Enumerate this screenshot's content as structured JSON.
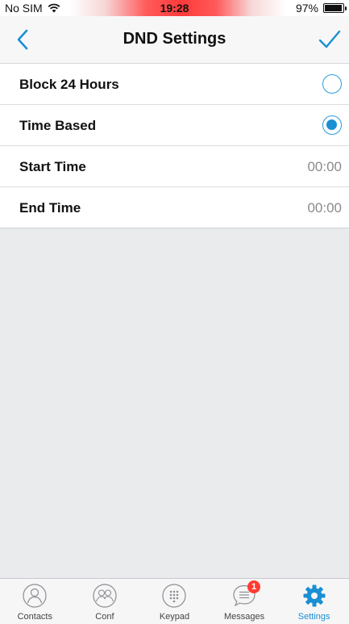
{
  "status_bar": {
    "carrier": "No SIM",
    "time": "19:28",
    "battery_text": "97%",
    "battery_level": 0.97
  },
  "nav": {
    "back_icon": "chevron-left-icon",
    "title": "DND Settings",
    "done_icon": "checkmark-icon"
  },
  "settings": {
    "rows": [
      {
        "label": "Block 24 Hours",
        "type": "radio",
        "selected": false
      },
      {
        "label": "Time Based",
        "type": "radio",
        "selected": true
      },
      {
        "label": "Start Time",
        "type": "value",
        "value": "00:00"
      },
      {
        "label": "End Time",
        "type": "value",
        "value": "00:00"
      }
    ]
  },
  "tabs": [
    {
      "label": "Contacts",
      "icon": "person-icon",
      "active": false
    },
    {
      "label": "Conf",
      "icon": "group-icon",
      "active": false
    },
    {
      "label": "Keypad",
      "icon": "keypad-icon",
      "active": false
    },
    {
      "label": "Messages",
      "icon": "chat-bubble-icon",
      "active": false,
      "badge": "1"
    },
    {
      "label": "Settings",
      "icon": "gear-icon",
      "active": true
    }
  ],
  "colors": {
    "accent": "#1a8fd4",
    "badge": "#ff3b30",
    "content_background": "#e9ebec"
  }
}
